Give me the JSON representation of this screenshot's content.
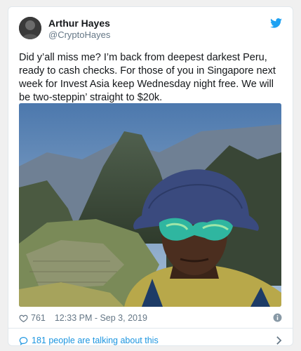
{
  "tweet": {
    "author": {
      "display_name": "Arthur Hayes",
      "handle": "@CryptoHayes"
    },
    "text": "Did y’all miss me? I’m back from deepest darkest Peru, ready to cash checks. For those of you in Singapore next week for Invest Asia keep Wednesday night free. We will be two-steppin’ straight to $20k.",
    "likes": "761",
    "timestamp": "12:33 PM - Sep 3, 2019",
    "conversation_link": "181 people are talking about this"
  },
  "icons": {
    "brand": "twitter-bird-icon",
    "like": "heart-icon",
    "info": "info-icon",
    "reply": "speech-bubble-icon",
    "more": "chevron-right-icon"
  },
  "colors": {
    "accent": "#1da1f2",
    "link": "#1b95e0",
    "muted": "#657786"
  }
}
